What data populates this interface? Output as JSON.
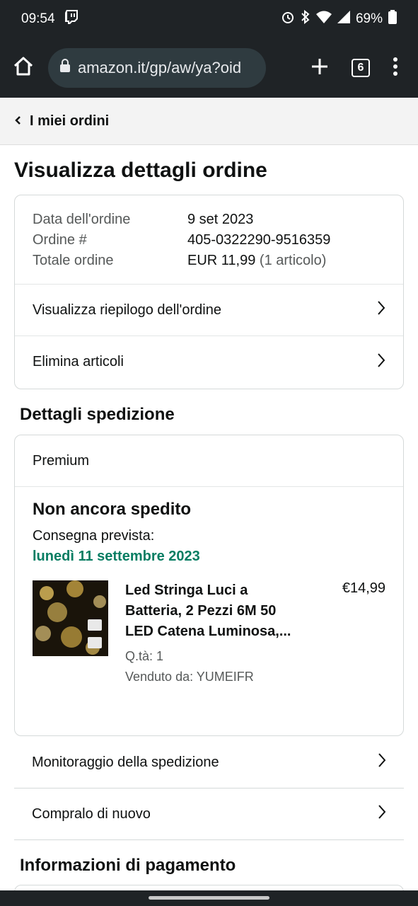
{
  "status_bar": {
    "time": "09:54",
    "battery": "69%"
  },
  "browser": {
    "url": "amazon.it/gp/aw/ya?oid",
    "tab_count": "6"
  },
  "breadcrumb": {
    "label": "I miei ordini"
  },
  "page": {
    "title": "Visualizza dettagli ordine"
  },
  "order_summary": {
    "date_label": "Data dell'ordine",
    "date_value": "9 set 2023",
    "number_label": "Ordine #",
    "number_value": "405-0322290-9516359",
    "total_label": "Totale ordine",
    "total_value": "EUR 11,99",
    "total_items": "(1 articolo)"
  },
  "order_actions": {
    "view_summary": "Visualizza riepilogo dell'ordine",
    "delete_items": "Elimina articoli"
  },
  "shipping": {
    "section_title": "Dettagli spedizione",
    "type": "Premium",
    "status": "Non ancora spedito",
    "delivery_label": "Consegna prevista:",
    "delivery_date": "lunedì 11 settembre 2023",
    "item": {
      "title": "Led Stringa Luci a Batteria, 2 Pezzi 6M 50 LED Catena Luminosa,...",
      "qty": "Q.tà: 1",
      "seller": "Venduto da: YUMEIFR",
      "price": "€14,99"
    },
    "track_label": "Monitoraggio della spedizione",
    "buy_again_label": "Compralo di nuovo"
  },
  "payment": {
    "section_title": "Informazioni di pagamento"
  },
  "colors": {
    "delivery_green": "#067d62",
    "dark_bar": "#1f2326"
  }
}
